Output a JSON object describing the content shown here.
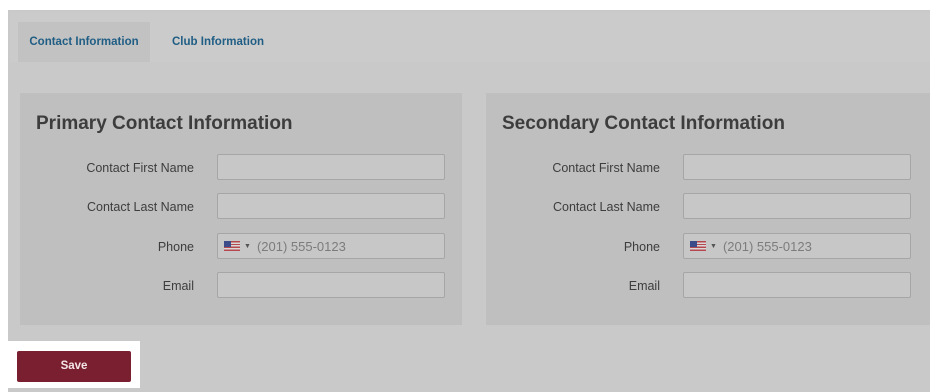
{
  "tabs": [
    {
      "label": "Contact Information",
      "active": true
    },
    {
      "label": "Club Information",
      "active": false
    }
  ],
  "primary": {
    "title": "Primary Contact Information",
    "fields": {
      "first_name_label": "Contact First Name",
      "first_name_value": "",
      "last_name_label": "Contact Last Name",
      "last_name_value": "",
      "phone_label": "Phone",
      "phone_placeholder": "(201) 555-0123",
      "phone_country": "us-flag-icon",
      "email_label": "Email",
      "email_value": ""
    }
  },
  "secondary": {
    "title": "Secondary Contact Information",
    "fields": {
      "first_name_label": "Contact First Name",
      "first_name_value": "",
      "last_name_label": "Contact Last Name",
      "last_name_value": "",
      "phone_label": "Phone",
      "phone_placeholder": "(201) 555-0123",
      "phone_country": "us-flag-icon",
      "email_label": "Email",
      "email_value": ""
    }
  },
  "actions": {
    "save_label": "Save"
  },
  "colors": {
    "tab_text": "#1f5d84",
    "save_button": "#7a1f30",
    "overlay_bg": "#c9c9c9",
    "panel_bg": "#bfbfbf"
  }
}
